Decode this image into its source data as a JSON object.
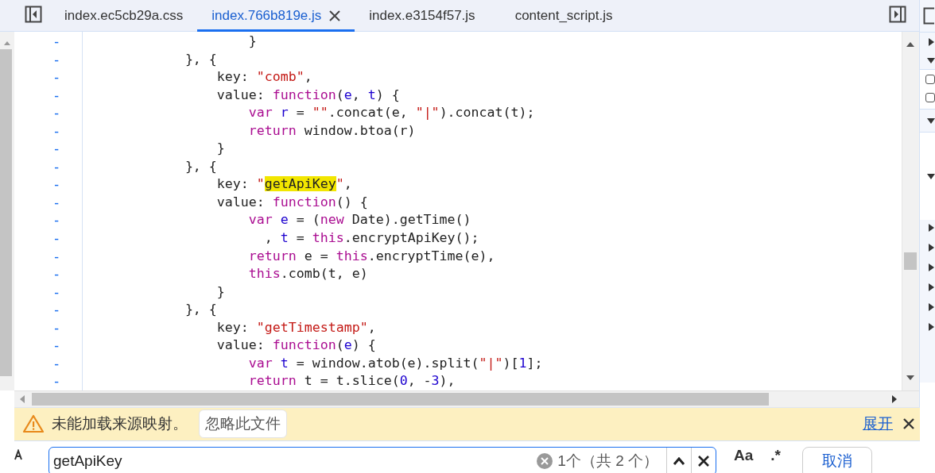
{
  "tabs": [
    {
      "label": "index.ec5cb29a.css",
      "selected": false
    },
    {
      "label": "index.766b819e.js",
      "selected": true
    },
    {
      "label": "index.e3154f57.js",
      "selected": false
    },
    {
      "label": "content_script.js",
      "selected": false
    }
  ],
  "code_lines": [
    {
      "marker": "-",
      "tokens": [
        {
          "kind": "plain",
          "text": "                    }"
        }
      ]
    },
    {
      "marker": "-",
      "tokens": [
        {
          "kind": "plain",
          "text": "            }, {"
        }
      ]
    },
    {
      "marker": "-",
      "tokens": [
        {
          "kind": "plain",
          "text": "                key: "
        },
        {
          "kind": "string",
          "text": "\"comb\""
        },
        {
          "kind": "plain",
          "text": ","
        }
      ]
    },
    {
      "marker": "-",
      "tokens": [
        {
          "kind": "plain",
          "text": "                value: "
        },
        {
          "kind": "keyword",
          "text": "function"
        },
        {
          "kind": "plain",
          "text": "("
        },
        {
          "kind": "variable",
          "text": "e"
        },
        {
          "kind": "plain",
          "text": ", "
        },
        {
          "kind": "variable",
          "text": "t"
        },
        {
          "kind": "plain",
          "text": ") {"
        }
      ]
    },
    {
      "marker": "-",
      "tokens": [
        {
          "kind": "keyword",
          "text": "                    var"
        },
        {
          "kind": "variable",
          "text": " r"
        },
        {
          "kind": "plain",
          "text": " = "
        },
        {
          "kind": "string",
          "text": "\"\""
        },
        {
          "kind": "plain",
          "text": ".concat(e, "
        },
        {
          "kind": "string",
          "text": "\"|\""
        },
        {
          "kind": "plain",
          "text": ").concat(t);"
        }
      ]
    },
    {
      "marker": "-",
      "tokens": [
        {
          "kind": "keyword",
          "text": "                    return"
        },
        {
          "kind": "plain",
          "text": " window.btoa(r)"
        }
      ]
    },
    {
      "marker": "-",
      "tokens": [
        {
          "kind": "plain",
          "text": "                }"
        }
      ]
    },
    {
      "marker": "-",
      "tokens": [
        {
          "kind": "plain",
          "text": "            }, {"
        }
      ]
    },
    {
      "marker": "-",
      "tokens": [
        {
          "kind": "plain",
          "text": "                key: "
        },
        {
          "kind": "string",
          "text": "\""
        },
        {
          "kind": "match",
          "text": "getApiKey"
        },
        {
          "kind": "string",
          "text": "\""
        },
        {
          "kind": "plain",
          "text": ","
        }
      ]
    },
    {
      "marker": "-",
      "tokens": [
        {
          "kind": "plain",
          "text": "                value: "
        },
        {
          "kind": "keyword",
          "text": "function"
        },
        {
          "kind": "plain",
          "text": "() {"
        }
      ]
    },
    {
      "marker": "-",
      "tokens": [
        {
          "kind": "keyword",
          "text": "                    var"
        },
        {
          "kind": "variable",
          "text": " e"
        },
        {
          "kind": "plain",
          "text": " = ("
        },
        {
          "kind": "keyword",
          "text": "new"
        },
        {
          "kind": "plain",
          "text": " Date).getTime()"
        }
      ]
    },
    {
      "marker": "-",
      "tokens": [
        {
          "kind": "plain",
          "text": "                      , "
        },
        {
          "kind": "variable",
          "text": "t"
        },
        {
          "kind": "plain",
          "text": " = "
        },
        {
          "kind": "keyword",
          "text": "this"
        },
        {
          "kind": "plain",
          "text": ".encryptApiKey();"
        }
      ]
    },
    {
      "marker": "-",
      "tokens": [
        {
          "kind": "keyword",
          "text": "                    return"
        },
        {
          "kind": "plain",
          "text": " e = "
        },
        {
          "kind": "keyword",
          "text": "this"
        },
        {
          "kind": "plain",
          "text": ".encryptTime(e),"
        }
      ]
    },
    {
      "marker": "-",
      "tokens": [
        {
          "kind": "keyword",
          "text": "                    this"
        },
        {
          "kind": "plain",
          "text": ".comb(t, e)"
        }
      ]
    },
    {
      "marker": "-",
      "tokens": [
        {
          "kind": "plain",
          "text": "                }"
        }
      ]
    },
    {
      "marker": "-",
      "tokens": [
        {
          "kind": "plain",
          "text": "            }, {"
        }
      ]
    },
    {
      "marker": "-",
      "tokens": [
        {
          "kind": "plain",
          "text": "                key: "
        },
        {
          "kind": "string",
          "text": "\"getTimestamp\""
        },
        {
          "kind": "plain",
          "text": ","
        }
      ]
    },
    {
      "marker": "-",
      "tokens": [
        {
          "kind": "plain",
          "text": "                value: "
        },
        {
          "kind": "keyword",
          "text": "function"
        },
        {
          "kind": "plain",
          "text": "("
        },
        {
          "kind": "variable",
          "text": "e"
        },
        {
          "kind": "plain",
          "text": ") {"
        }
      ]
    },
    {
      "marker": "-",
      "tokens": [
        {
          "kind": "keyword",
          "text": "                    var"
        },
        {
          "kind": "variable",
          "text": " t"
        },
        {
          "kind": "plain",
          "text": " = window.atob(e).split("
        },
        {
          "kind": "string",
          "text": "\"|\""
        },
        {
          "kind": "plain",
          "text": ")["
        },
        {
          "kind": "number",
          "text": "1"
        },
        {
          "kind": "plain",
          "text": "];"
        }
      ]
    },
    {
      "marker": "-",
      "tokens": [
        {
          "kind": "keyword",
          "text": "                    return"
        },
        {
          "kind": "plain",
          "text": " t = t.slice("
        },
        {
          "kind": "number",
          "text": "0"
        },
        {
          "kind": "plain",
          "text": ", -"
        },
        {
          "kind": "number",
          "text": "3"
        },
        {
          "kind": "plain",
          "text": "),"
        }
      ]
    }
  ],
  "sidebar": {
    "checkboxes": [
      {
        "checked": false
      },
      {
        "checked": false
      }
    ]
  },
  "infobar": {
    "message": "未能加载来源映射。",
    "action": "忽略此文件",
    "link": "展开"
  },
  "search": {
    "value": "getApiKey",
    "count": "1个（共 2 个）",
    "case_toggle": "Aa",
    "regex_toggle": ".*",
    "cancel": "取消"
  }
}
